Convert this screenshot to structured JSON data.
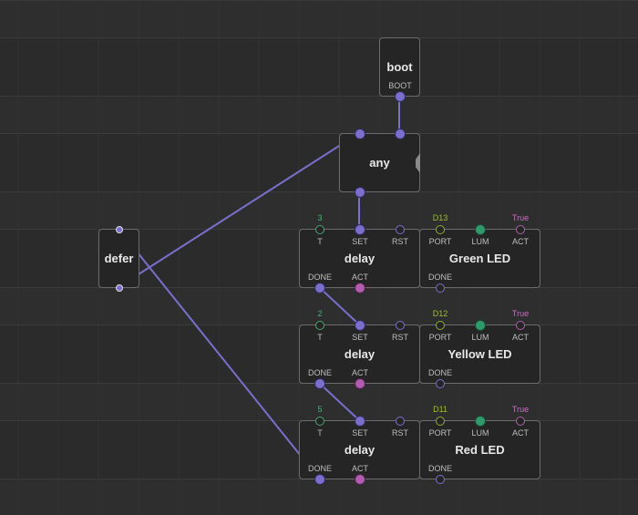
{
  "editor": {
    "theme_colors": {
      "background": "#2b2b2b",
      "node_fill": "#252525",
      "node_border": "#6b6b6b",
      "pulse_link": "#7a6fcf",
      "bool_link": "#6b3f6a",
      "number_pin": "#2f9a6a",
      "port_value": "#9dc02b",
      "bool_value": "#c56fc3"
    }
  },
  "nodes": {
    "boot": {
      "title": "boot",
      "pins": {
        "out": "BOOT"
      }
    },
    "any": {
      "title": "any"
    },
    "defer": {
      "title": "defer"
    },
    "delay1": {
      "title": "delay",
      "inputs": [
        {
          "label": "T",
          "value": "3"
        },
        {
          "label": "SET"
        },
        {
          "label": "RST"
        }
      ],
      "outputs": [
        {
          "label": "DONE"
        },
        {
          "label": "ACT"
        }
      ]
    },
    "led1": {
      "title": "Green LED",
      "inputs": [
        {
          "label": "PORT",
          "value": "D13"
        },
        {
          "label": "LUM"
        },
        {
          "label": "ACT",
          "value": "True"
        }
      ],
      "outputs": [
        {
          "label": "DONE"
        }
      ]
    },
    "delay2": {
      "title": "delay",
      "inputs": [
        {
          "label": "T",
          "value": "2"
        },
        {
          "label": "SET"
        },
        {
          "label": "RST"
        }
      ],
      "outputs": [
        {
          "label": "DONE"
        },
        {
          "label": "ACT"
        }
      ]
    },
    "led2": {
      "title": "Yellow LED",
      "inputs": [
        {
          "label": "PORT",
          "value": "D12"
        },
        {
          "label": "LUM"
        },
        {
          "label": "ACT",
          "value": "True"
        }
      ],
      "outputs": [
        {
          "label": "DONE"
        }
      ]
    },
    "delay3": {
      "title": "delay",
      "inputs": [
        {
          "label": "T",
          "value": "5"
        },
        {
          "label": "SET"
        },
        {
          "label": "RST"
        }
      ],
      "outputs": [
        {
          "label": "DONE"
        },
        {
          "label": "ACT"
        }
      ]
    },
    "led3": {
      "title": "Red LED",
      "inputs": [
        {
          "label": "PORT",
          "value": "D11"
        },
        {
          "label": "LUM"
        },
        {
          "label": "ACT",
          "value": "True"
        }
      ],
      "outputs": [
        {
          "label": "DONE"
        }
      ]
    }
  },
  "links": [
    {
      "from": "boot.BOOT",
      "to": "any.in2",
      "type": "pulse"
    },
    {
      "from": "defer.out",
      "to": "any.in1",
      "type": "pulse"
    },
    {
      "from": "any.out",
      "to": "delay1.SET",
      "type": "pulse"
    },
    {
      "from": "delay1.DONE",
      "to": "delay2.SET",
      "type": "pulse"
    },
    {
      "from": "delay2.DONE",
      "to": "delay3.SET",
      "type": "pulse"
    },
    {
      "from": "delay3.DONE",
      "to": "defer.in",
      "type": "pulse"
    },
    {
      "from": "delay1.ACT",
      "to": "led1.LUM",
      "type": "boolean"
    },
    {
      "from": "delay2.ACT",
      "to": "led2.LUM",
      "type": "boolean"
    },
    {
      "from": "delay3.ACT",
      "to": "led3.LUM",
      "type": "boolean"
    }
  ]
}
